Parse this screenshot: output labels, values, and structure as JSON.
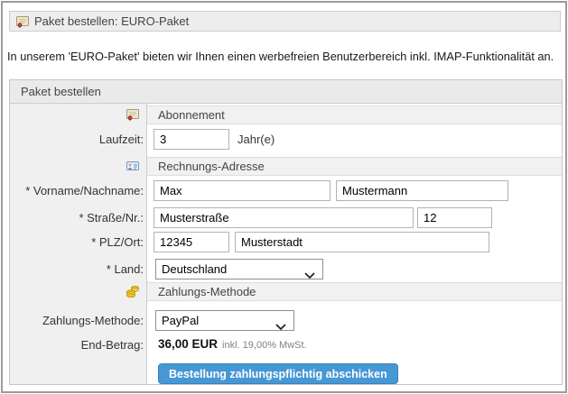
{
  "titlebar": {
    "title": "Paket bestellen: EURO-Paket"
  },
  "intro": {
    "text": "In unserem 'EURO-Paket' bieten wir Ihnen einen werbefreien Benutzerbereich inkl. IMAP-Funktionalität an."
  },
  "panel": {
    "title": "Paket bestellen"
  },
  "subscription": {
    "section_title": "Abonnement",
    "laufzeit_label": "Laufzeit:",
    "laufzeit_value": "3",
    "laufzeit_unit": "Jahr(e)"
  },
  "address": {
    "section_title": "Rechnungs-Adresse",
    "name_label": "* Vorname/Nachname:",
    "firstname": "Max",
    "lastname": "Mustermann",
    "street_label": "* Straße/Nr.:",
    "street": "Musterstraße",
    "house_number": "12",
    "city_label": "* PLZ/Ort:",
    "zip": "12345",
    "city": "Musterstadt",
    "country_label": "* Land:",
    "country": "Deutschland"
  },
  "payment": {
    "section_title": "Zahlungs-Methode",
    "method_label": "Zahlungs-Methode:",
    "method": "PayPal",
    "total_label": "End-Betrag:",
    "total_amount": "36,00 EUR",
    "tax_note": "inkl. 19,00% MwSt.",
    "submit_label": "Bestellung zahlungspflichtig abschicken"
  },
  "icons": {
    "package": "package-icon",
    "vcard": "vcard-icon",
    "coins": "coins-icon",
    "chevron_down": "chevron-down-icon"
  },
  "colors": {
    "button_bg": "#4697d4",
    "button_border": "#3583c0",
    "titlebar_bg": "#ededed",
    "panel_header_bg": "#eaeaea",
    "section_bar_bg": "#f1f1f1",
    "label_column_bg": "#f0f0f0",
    "border": "#cccccc"
  }
}
